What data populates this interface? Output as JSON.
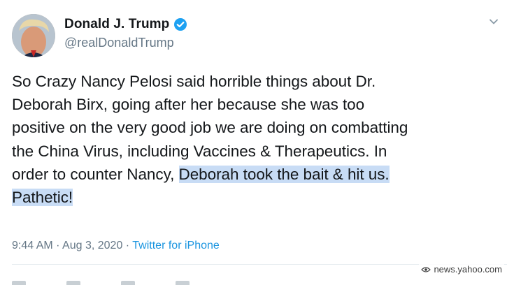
{
  "tweet": {
    "author": {
      "display_name": "Donald J. Trump",
      "handle": "@realDonaldTrump",
      "verified": true,
      "verified_badge_color": "#1da1f2"
    },
    "text_lines": [
      "So Crazy Nancy Pelosi said horrible things about Dr.",
      "Deborah Birx, going after her because she was too",
      "positive on the very good job we are doing on combatting",
      "the China Virus, including Vaccines & Therapeutics. In",
      "order to counter Nancy, ",
      "Deborah took the bait & hit us.",
      "Pathetic!"
    ],
    "highlight_color": "#c8dcf5",
    "time": "9:44 AM",
    "date": "Aug 3, 2020",
    "separator": "·",
    "source": "Twitter for iPhone",
    "source_color": "#1b95e0"
  },
  "watermark": {
    "text": "news.yahoo.com"
  },
  "icons": {
    "verified": "verified-badge-icon",
    "menu": "chevron-down-icon",
    "watermark": "eye-icon"
  }
}
